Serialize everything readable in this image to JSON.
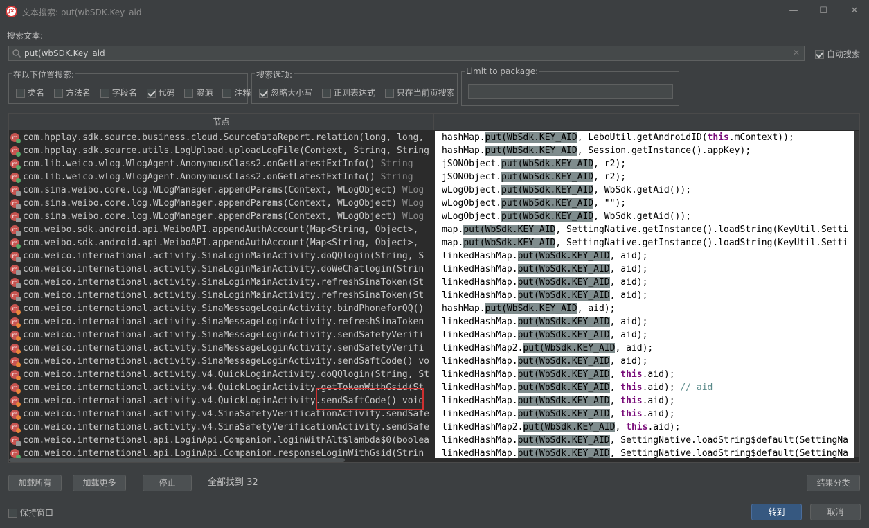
{
  "window": {
    "title": "文本搜索: put(wbSDK.Key_aid",
    "minimize": "—",
    "maximize": "☐",
    "close": "✕"
  },
  "search": {
    "label": "搜索文本:",
    "value": "put(wbSDK.Key_aid",
    "auto_search": "自动搜索"
  },
  "scope": {
    "title": "在以下位置搜索:",
    "options": [
      {
        "label": "类名",
        "checked": false
      },
      {
        "label": "方法名",
        "checked": false
      },
      {
        "label": "字段名",
        "checked": false
      },
      {
        "label": "代码",
        "checked": true
      },
      {
        "label": "资源",
        "checked": false
      },
      {
        "label": "注释",
        "checked": false
      }
    ]
  },
  "search_options": {
    "title": "搜索选项:",
    "options": [
      {
        "label": "忽略大小写",
        "checked": true
      },
      {
        "label": "正则表达式",
        "checked": false
      },
      {
        "label": "只在当前页搜索",
        "checked": false
      }
    ]
  },
  "package": {
    "title": "Limit to package:",
    "value": ""
  },
  "results": {
    "header": "节点",
    "rows": [
      {
        "text": "com.hpplay.sdk.source.business.cloud.SourceDataReport.relation(long, long, ",
        "type": "",
        "dot": "green"
      },
      {
        "text": "com.hpplay.sdk.source.utils.LogUpload.uploadLogFile(Context, String, String",
        "type": "",
        "dot": "green"
      },
      {
        "text": "com.lib.weico.wlog.WlogAgent.AnonymousClass2.onGetLatestExtInfo() ",
        "type": "String",
        "dot": "green"
      },
      {
        "text": "com.lib.weico.wlog.WlogAgent.AnonymousClass2.onGetLatestExtInfo() ",
        "type": "String",
        "dot": "green"
      },
      {
        "text": "com.sina.weibo.core.log.WLogManager.appendParams(Context, WLogObject) ",
        "type": "WLog",
        "dot": "lock"
      },
      {
        "text": "com.sina.weibo.core.log.WLogManager.appendParams(Context, WLogObject) ",
        "type": "WLog",
        "dot": "lock"
      },
      {
        "text": "com.sina.weibo.core.log.WLogManager.appendParams(Context, WLogObject) ",
        "type": "WLog",
        "dot": "lock"
      },
      {
        "text": "com.weibo.sdk.android.api.WeiboAPI.appendAuthAccount(Map<String, Object>, ",
        "type": "",
        "dot": "lock"
      },
      {
        "text": "com.weibo.sdk.android.api.WeiboAPI.appendAuthAccount(Map<String, Object>, ",
        "type": "",
        "dot": "green"
      },
      {
        "text": "com.weico.international.activity.SinaLoginMainActivity.doQQlogin(String, S",
        "type": "",
        "dot": "lock"
      },
      {
        "text": "com.weico.international.activity.SinaLoginMainActivity.doWeChatlogin(Strin",
        "type": "",
        "dot": "lock"
      },
      {
        "text": "com.weico.international.activity.SinaLoginMainActivity.refreshSinaToken(St",
        "type": "",
        "dot": "lock"
      },
      {
        "text": "com.weico.international.activity.SinaLoginMainActivity.refreshSinaToken(St",
        "type": "",
        "dot": "lock"
      },
      {
        "text": "com.weico.international.activity.SinaMessageLoginActivity.bindPhoneforQQ()",
        "type": "",
        "dot": "orange"
      },
      {
        "text": "com.weico.international.activity.SinaMessageLoginActivity.refreshSinaToken",
        "type": "",
        "dot": "orange"
      },
      {
        "text": "com.weico.international.activity.SinaMessageLoginActivity.sendSafetyVerifi",
        "type": "",
        "dot": "orange"
      },
      {
        "text": "com.weico.international.activity.SinaMessageLoginActivity.sendSafetyVerifi",
        "type": "",
        "dot": "orange"
      },
      {
        "text": "com.weico.international.activity.SinaMessageLoginActivity.sendSaftCode() vo",
        "type": "",
        "dot": "orange"
      },
      {
        "text": "com.weico.international.activity.v4.QuickLoginActivity.doQQlogin(String, St",
        "type": "",
        "dot": "orange"
      },
      {
        "text": "com.weico.international.activity.v4.QuickLoginActivity.getTokenWithGsid(St",
        "type": "",
        "dot": "orange"
      },
      {
        "text": "com.weico.international.activity.v4.QuickLoginActivity.sendSaftCode() void",
        "type": "",
        "dot": "orange"
      },
      {
        "text": "com.weico.international.activity.v4.SinaSafetyVerificationActivity.sendSafe",
        "type": "",
        "dot": "orange"
      },
      {
        "text": "com.weico.international.activity.v4.SinaSafetyVerificationActivity.sendSafe",
        "type": "",
        "dot": "orange"
      },
      {
        "text": "com.weico.international.api.LoginApi.Companion.loginWithAlt$lambda$0(boolea",
        "type": "",
        "dot": "lock"
      },
      {
        "text": "com.weico.international.api.LoginApi.Companion.responseLoginWithGsid(Strin",
        "type": "",
        "dot": "green"
      }
    ],
    "code": [
      {
        "pre": "hashMap.",
        "hl": "put(WbSdk.KEY_AID",
        "post": ", LeboUtil.getAndroidID(",
        "kw": "this",
        "post2": ".mContext));",
        "cm": ""
      },
      {
        "pre": "hashMap.",
        "hl": "put(WbSdk.KEY_AID",
        "post": ", Session.getInstance().appKey);",
        "kw": "",
        "post2": "",
        "cm": ""
      },
      {
        "pre": "jSONObject.",
        "hl": "put(WbSdk.KEY_AID",
        "post": ", r2);",
        "kw": "",
        "post2": "",
        "cm": ""
      },
      {
        "pre": "jSONObject.",
        "hl": "put(WbSdk.KEY_AID",
        "post": ", r2);",
        "kw": "",
        "post2": "",
        "cm": ""
      },
      {
        "pre": "wLogObject.",
        "hl": "put(WbSdk.KEY_AID",
        "post": ", WbSdk.getAid());",
        "kw": "",
        "post2": "",
        "cm": ""
      },
      {
        "pre": "wLogObject.",
        "hl": "put(WbSdk.KEY_AID",
        "post": ", \"\");",
        "kw": "",
        "post2": "",
        "cm": ""
      },
      {
        "pre": "wLogObject.",
        "hl": "put(WbSdk.KEY_AID",
        "post": ", WbSdk.getAid());",
        "kw": "",
        "post2": "",
        "cm": ""
      },
      {
        "pre": "map.",
        "hl": "put(WbSdk.KEY_AID",
        "post": ", SettingNative.getInstance().loadString(KeyUtil.Setti",
        "kw": "",
        "post2": "",
        "cm": ""
      },
      {
        "pre": "map.",
        "hl": "put(WbSdk.KEY_AID",
        "post": ", SettingNative.getInstance().loadString(KeyUtil.Setti",
        "kw": "",
        "post2": "",
        "cm": ""
      },
      {
        "pre": "linkedHashMap.",
        "hl": "put(WbSdk.KEY_AID",
        "post": ", aid);",
        "kw": "",
        "post2": "",
        "cm": ""
      },
      {
        "pre": "linkedHashMap.",
        "hl": "put(WbSdk.KEY_AID",
        "post": ", aid);",
        "kw": "",
        "post2": "",
        "cm": ""
      },
      {
        "pre": "linkedHashMap.",
        "hl": "put(WbSdk.KEY_AID",
        "post": ", aid);",
        "kw": "",
        "post2": "",
        "cm": ""
      },
      {
        "pre": "linkedHashMap.",
        "hl": "put(WbSdk.KEY_AID",
        "post": ", aid);",
        "kw": "",
        "post2": "",
        "cm": ""
      },
      {
        "pre": "hashMap.",
        "hl": "put(WbSdk.KEY_AID",
        "post": ", aid);",
        "kw": "",
        "post2": "",
        "cm": ""
      },
      {
        "pre": "linkedHashMap.",
        "hl": "put(WbSdk.KEY_AID",
        "post": ", aid);",
        "kw": "",
        "post2": "",
        "cm": ""
      },
      {
        "pre": "linkedHashMap.",
        "hl": "put(WbSdk.KEY_AID",
        "post": ", aid);",
        "kw": "",
        "post2": "",
        "cm": ""
      },
      {
        "pre": "linkedHashMap2.",
        "hl": "put(WbSdk.KEY_AID",
        "post": ", aid);",
        "kw": "",
        "post2": "",
        "cm": ""
      },
      {
        "pre": "linkedHashMap.",
        "hl": "put(WbSdk.KEY_AID",
        "post": ", aid);",
        "kw": "",
        "post2": "",
        "cm": ""
      },
      {
        "pre": "linkedHashMap.",
        "hl": "put(WbSdk.KEY_AID",
        "post": ", ",
        "kw": "this",
        "post2": ".aid);",
        "cm": ""
      },
      {
        "pre": "linkedHashMap.",
        "hl": "put(WbSdk.KEY_AID",
        "post": ", ",
        "kw": "this",
        "post2": ".aid); ",
        "cm": "// aid"
      },
      {
        "pre": "linkedHashMap.",
        "hl": "put(WbSdk.KEY_AID",
        "post": ", ",
        "kw": "this",
        "post2": ".aid);",
        "cm": ""
      },
      {
        "pre": "linkedHashMap.",
        "hl": "put(WbSdk.KEY_AID",
        "post": ", ",
        "kw": "this",
        "post2": ".aid);",
        "cm": ""
      },
      {
        "pre": "linkedHashMap2.",
        "hl": "put(WbSdk.KEY_AID",
        "post": ", ",
        "kw": "this",
        "post2": ".aid);",
        "cm": ""
      },
      {
        "pre": "linkedHashMap.",
        "hl": "put(WbSdk.KEY_AID",
        "post": ", SettingNative.loadString$default(SettingNa",
        "kw": "",
        "post2": "",
        "cm": ""
      },
      {
        "pre": "linkedHashMap.",
        "hl": "put(WbSdk.KEY_AID",
        "post": ", SettingNative.loadString$default(SettingNa",
        "kw": "",
        "post2": "",
        "cm": ""
      }
    ]
  },
  "footer": {
    "load_all": "加载所有",
    "load_more": "加载更多",
    "stop": "停止",
    "found": "全部找到  32",
    "classify": "结果分类",
    "keep_window": "保持窗口",
    "goto": "转到",
    "cancel": "取消"
  }
}
